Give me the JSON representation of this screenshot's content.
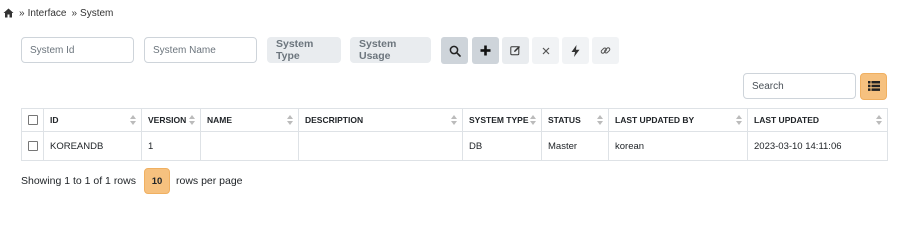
{
  "breadcrumb": {
    "items": [
      "Interface",
      "System"
    ],
    "separator": "»"
  },
  "filters": {
    "system_id_placeholder": "System Id",
    "system_name_placeholder": "System Name",
    "system_type_label": "System Type",
    "system_usage_label": "System Usage"
  },
  "toolbar": {
    "buttons": [
      "search-icon",
      "plus-icon",
      "edit-icon",
      "close-icon",
      "bolt-icon",
      "link-icon"
    ]
  },
  "search": {
    "placeholder": "Search"
  },
  "table": {
    "columns": [
      "ID",
      "VERSION",
      "NAME",
      "DESCRIPTION",
      "SYSTEM TYPE",
      "STATUS",
      "LAST UPDATED BY",
      "LAST UPDATED"
    ],
    "rows": [
      {
        "id": "KOREANDB",
        "version": "1",
        "name": "",
        "description": "",
        "system_type": "DB",
        "status": "Master",
        "last_updated_by": "korean",
        "last_updated": "2023-03-10 14:11:06"
      }
    ]
  },
  "pagination": {
    "showing_text": "Showing 1 to 1 of 1 rows",
    "page_size": "10",
    "rows_per_page_text": "rows per page"
  },
  "colors": {
    "accent": "#f6c17f",
    "accent_border": "#f0b061",
    "button_bg": "#e9ecef"
  }
}
